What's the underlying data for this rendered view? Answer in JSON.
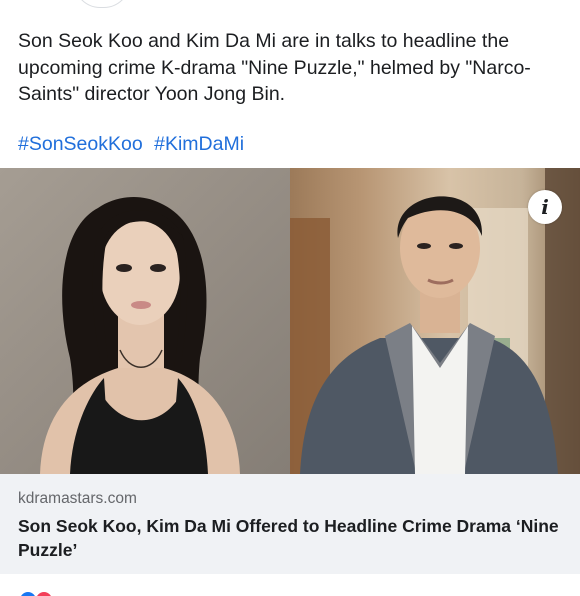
{
  "post": {
    "text": "Son Seok Koo and Kim Da Mi are in talks to headline the upcoming crime K-drama \"Nine Puzzle,\" helmed by \"Narco-Saints\" director Yoon Jong Bin.",
    "hashtags": [
      "#SonSeokKoo",
      "#KimDaMi"
    ]
  },
  "media": {
    "info_icon": "info-icon",
    "info_glyph": "i"
  },
  "link_card": {
    "domain": "kdramastars.com",
    "title": "Son Seok Koo, Kim Da Mi Offered to Headline Crime Drama ‘Nine Puzzle’"
  },
  "colors": {
    "hashtag": "#216fdb",
    "card_background": "#f0f2f5",
    "like": "#1877f2",
    "love": "#f33e58"
  }
}
